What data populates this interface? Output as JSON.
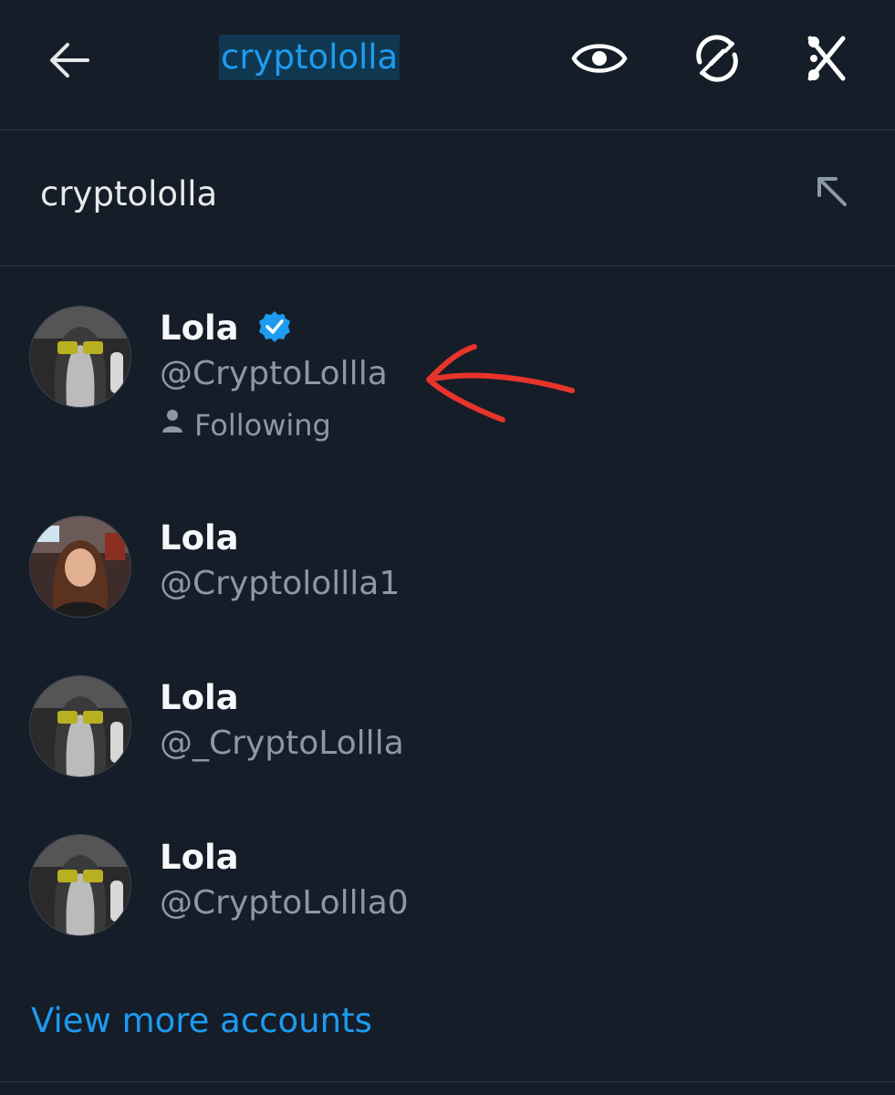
{
  "header": {
    "query": "cryptololla",
    "icons": {
      "back": "back-arrow-icon",
      "view": "eye-icon",
      "sync": "sync-icon",
      "cut": "scissors-icon"
    }
  },
  "search": {
    "text": "cryptololla",
    "fill_icon": "arrow-up-left-icon"
  },
  "results": [
    {
      "name": "Lola",
      "handle": "@CryptoLollla",
      "verified": true,
      "following": "Following"
    },
    {
      "name": "Lola",
      "handle": "@Cryptolollla1",
      "verified": false
    },
    {
      "name": "Lola",
      "handle": "@_CryptoLollla",
      "verified": false
    },
    {
      "name": "Lola",
      "handle": "@CryptoLollla0",
      "verified": false
    }
  ],
  "view_more": "View more accounts",
  "colors": {
    "accent": "#1d9bf0",
    "background": "#151d28",
    "annotation": "#e8342b"
  }
}
